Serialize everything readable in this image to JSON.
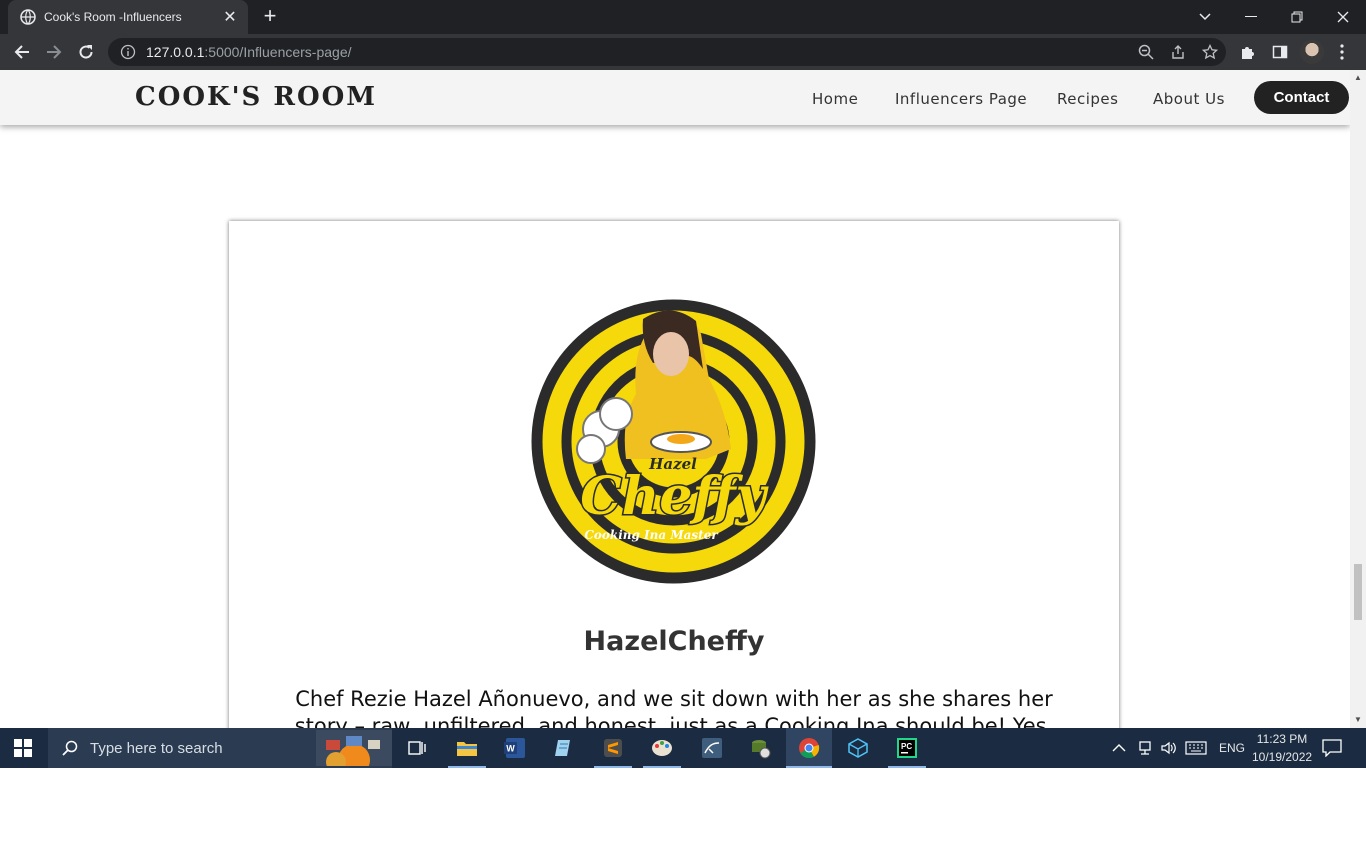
{
  "browser": {
    "tab_title": "Cook's Room -Influencers",
    "url_host": "127.0.0.1",
    "url_rest": ":5000/Influencers-page/"
  },
  "site": {
    "logo": "COOK'S ROOM",
    "nav": [
      "Home",
      "Influencers Page",
      "Recipes",
      "About Us"
    ],
    "contact": "Contact"
  },
  "profile": {
    "logo_text_small": "Hazel",
    "logo_text_big": "Cheffy",
    "logo_tagline": "Cooking Ina Master",
    "name": "HazelCheffy",
    "bio_line1": "Chef Rezie Hazel Añonuevo, and we sit down with her as she shares her",
    "bio_line2": "story – raw, unfiltered, and honest, just as a Cooking Ina should be! Yes,"
  },
  "taskbar": {
    "search_placeholder": "Type here to search",
    "lang": "ENG",
    "time": "11:23 PM",
    "date": "10/19/2022"
  },
  "colors": {
    "brand_yellow": "#f5d90a",
    "logo_dark": "#2b2b2b",
    "header_bg": "#f4f4f4",
    "contact_bg": "#222222"
  }
}
